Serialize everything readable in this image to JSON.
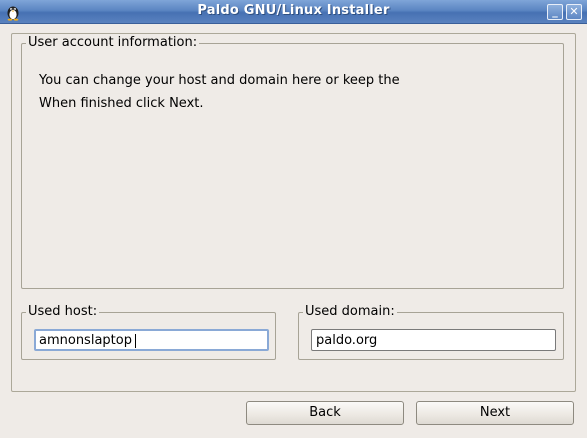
{
  "window": {
    "title": "Paldo GNU/Linux Installer",
    "minimize_glyph": "_",
    "close_glyph": "✕"
  },
  "account_group": {
    "legend": "User account information:",
    "line1": "You can change your host and domain here or keep the",
    "line2": "When finished click Next."
  },
  "host_group": {
    "legend": "Used host:",
    "value": "amnonslaptop"
  },
  "domain_group": {
    "legend": "Used domain:",
    "value": "paldo.org"
  },
  "buttons": {
    "back_label": "Back",
    "next_label": "Next"
  },
  "colors": {
    "titlebar": "#5b85c2",
    "window_bg": "#efebe7",
    "focus_border": "#8aa9d6"
  },
  "icons": {
    "app": "tux-penguin-icon",
    "minimize": "minimize-icon",
    "close": "close-icon"
  }
}
